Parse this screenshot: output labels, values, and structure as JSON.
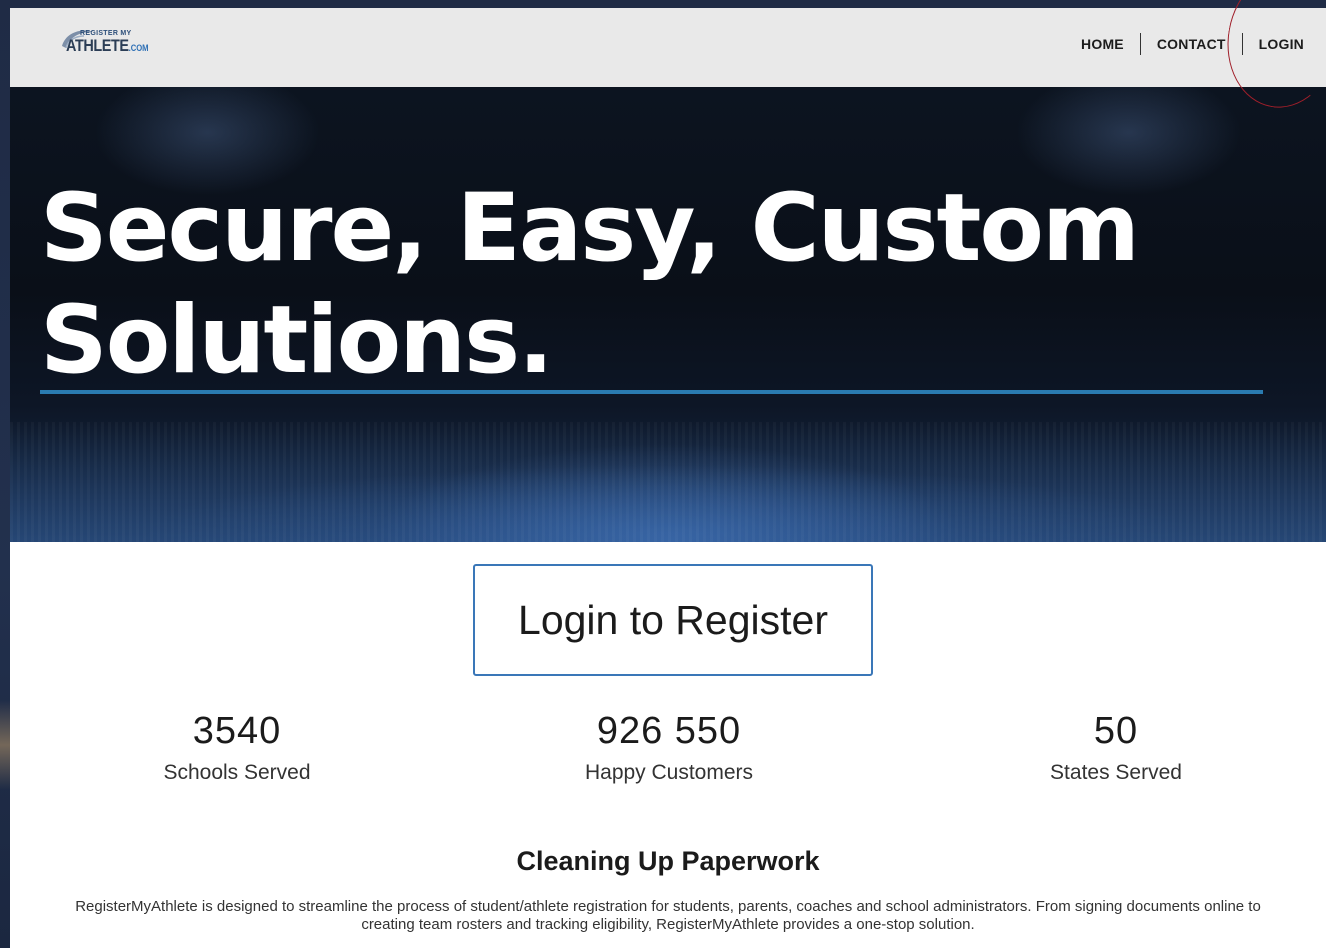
{
  "header": {
    "logo": {
      "small_text": "REGISTER MY",
      "big_text": "ATHLETE",
      "suffix": ".COM"
    },
    "nav": [
      {
        "label": "HOME"
      },
      {
        "label": "CONTACT"
      },
      {
        "label": "LOGIN"
      }
    ]
  },
  "hero": {
    "title_line1": "Secure, Easy, Custom",
    "title_line2": "Solutions."
  },
  "cta": {
    "label": "Login to Register"
  },
  "stats": [
    {
      "value": "3540",
      "label": "Schools Served"
    },
    {
      "value": "926 550",
      "label": "Happy Customers"
    },
    {
      "value": "50",
      "label": "States Served"
    }
  ],
  "about": {
    "title": "Cleaning Up Paperwork",
    "text": "RegisterMyAthlete is designed to streamline the process of student/athlete registration for students, parents, coaches and school administrators. From signing documents online to creating team rosters and tracking eligibility, RegisterMyAthlete provides a one-stop solution."
  },
  "colors": {
    "accent_line": "#2a7bb0",
    "button_border": "#3a77b8",
    "annotation_circle": "#a01f2a"
  }
}
